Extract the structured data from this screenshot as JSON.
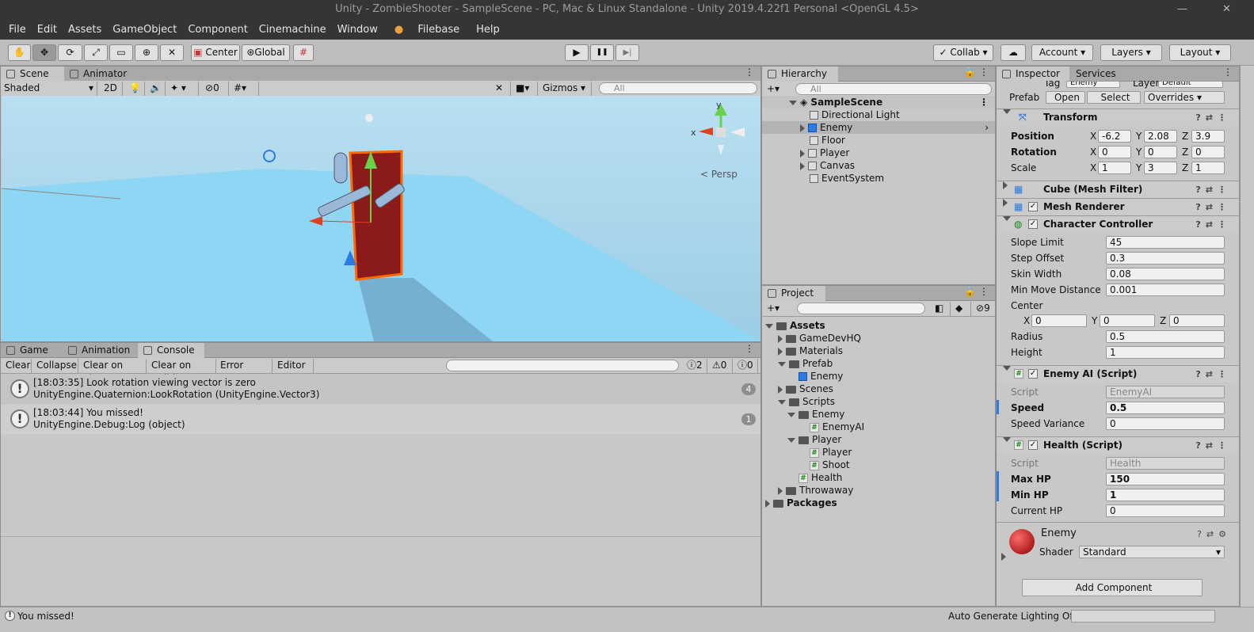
{
  "window": {
    "title": "Unity - ZombieShooter - SampleScene - PC, Mac & Linux Standalone - Unity 2019.4.22f1 Personal <OpenGL 4.5>",
    "minimize": "—",
    "close": "✕"
  },
  "menu": [
    "File",
    "Edit",
    "Assets",
    "GameObject",
    "Component",
    "Cinemachine",
    "Window",
    "Filebase",
    "Help"
  ],
  "toolbar": {
    "center_label": "Center",
    "global_label": "Global",
    "collab_label": "Collab",
    "account_label": "Account",
    "layers_label": "Layers",
    "layout_label": "Layout",
    "play": "▶",
    "pause": "❚❚",
    "step": "▶|"
  },
  "scene_panel": {
    "tabs": [
      "Scene",
      "Animator"
    ],
    "shading": "Shaded",
    "mode_2d": "2D",
    "hidden_count": "0",
    "gizmos_label": "Gizmos",
    "search_placeholder": "All",
    "persp_label": "Persp",
    "axis_y": "y",
    "axis_x": "x"
  },
  "console_panel": {
    "tabs": [
      "Game",
      "Animation",
      "Console"
    ],
    "buttons": [
      "Clear",
      "Collapse",
      "Clear on Play",
      "Clear on Build",
      "Error Pause",
      "Editor"
    ],
    "counts": {
      "info": "2",
      "warn": "0",
      "error": "0"
    },
    "messages": [
      {
        "line1": "[18:03:35] Look rotation viewing vector is zero",
        "line2": "UnityEngine.Quaternion:LookRotation (UnityEngine.Vector3)",
        "count": "4"
      },
      {
        "line1": "[18:03:44] You missed!",
        "line2": "UnityEngine.Debug:Log (object)",
        "count": "1"
      }
    ]
  },
  "hierarchy": {
    "tab": "Hierarchy",
    "search_placeholder": "All",
    "scene": "SampleScene",
    "items": [
      "Directional Light",
      "Enemy",
      "Floor",
      "Player",
      "Canvas",
      "EventSystem"
    ]
  },
  "project": {
    "tab": "Project",
    "hidden_count": "9",
    "tree": [
      "Assets",
      "GameDevHQ",
      "Materials",
      "Prefab",
      "Enemy",
      "Scenes",
      "Scripts",
      "Enemy",
      "EnemyAI",
      "Player",
      "Player",
      "Shoot",
      "Health",
      "Throwaway",
      "Packages"
    ]
  },
  "inspector": {
    "tabs": [
      "Inspector",
      "Services"
    ],
    "tag_label": "Tag",
    "tag_value": "Enemy",
    "layer_label": "Layer",
    "layer_value": "Default",
    "prefab_label": "Prefab",
    "prefab_buttons": [
      "Open",
      "Select",
      "Overrides"
    ],
    "transform": {
      "title": "Transform",
      "position_label": "Position",
      "pos": [
        "-6.2",
        "2.08",
        "3.9"
      ],
      "rotation_label": "Rotation",
      "rot": [
        "0",
        "0",
        "0"
      ],
      "scale_label": "Scale",
      "scl": [
        "1",
        "3",
        "1"
      ],
      "axis": [
        "X",
        "Y",
        "Z"
      ]
    },
    "mesh_filter": "Cube (Mesh Filter)",
    "mesh_renderer": "Mesh Renderer",
    "char_controller": {
      "title": "Character Controller",
      "fields": [
        {
          "label": "Slope Limit",
          "value": "45"
        },
        {
          "label": "Step Offset",
          "value": "0.3"
        },
        {
          "label": "Skin Width",
          "value": "0.08"
        },
        {
          "label": "Min Move Distance",
          "value": "0.001"
        }
      ],
      "center_label": "Center",
      "center": [
        "0",
        "0",
        "0"
      ],
      "radius_label": "Radius",
      "radius": "0.5",
      "height_label": "Height",
      "height": "1"
    },
    "enemy_ai": {
      "title": "Enemy AI (Script)",
      "script_label": "Script",
      "script_value": "EnemyAI",
      "speed_label": "Speed",
      "speed": "0.5",
      "variance_label": "Speed Variance",
      "variance": "0"
    },
    "health": {
      "title": "Health (Script)",
      "script_label": "Script",
      "script_value": "Health",
      "max_label": "Max HP",
      "max": "150",
      "min_label": "Min HP",
      "min": "1",
      "cur_label": "Current HP",
      "cur": "0"
    },
    "material": {
      "name": "Enemy",
      "shader_label": "Shader",
      "shader": "Standard"
    },
    "add_component": "Add Component"
  },
  "status": {
    "message": "You missed!",
    "lighting": "Auto Generate Lighting Off"
  },
  "colors": {
    "selection": "#ff6a00",
    "enemy_body": "#8b1a1a",
    "floor": "#8fd6f5"
  }
}
